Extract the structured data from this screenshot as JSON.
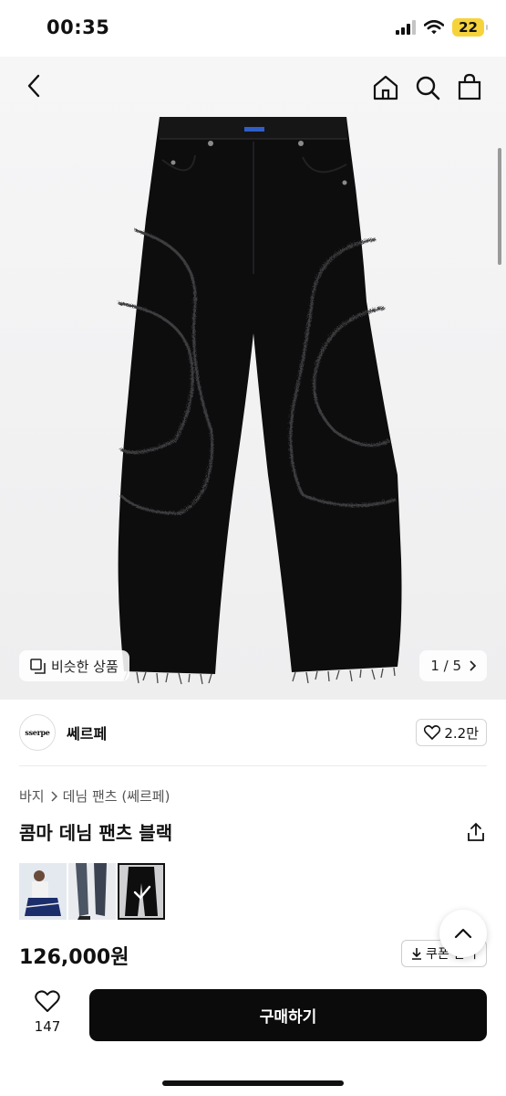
{
  "status_bar": {
    "time": "00:35",
    "battery": "22"
  },
  "gallery": {
    "similar_label": "비슷한 상품",
    "page_indicator": "1 / 5"
  },
  "brand": {
    "logo_text": "sserpe",
    "name": "쎄르페",
    "likes": "2.2만"
  },
  "breadcrumb": {
    "level1": "바지",
    "level2": "데님 팬츠 (쎄르페)"
  },
  "product": {
    "title": "콤마 데님 팬츠 블랙",
    "price": "126,000원"
  },
  "coupon": {
    "label": "쿠폰 받기"
  },
  "bottom_bar": {
    "wish_count": "147",
    "buy_label": "구매하기"
  },
  "colors": {
    "button": "#0b0b0b",
    "battery": "#f6d33b",
    "background": "#ffffff"
  }
}
